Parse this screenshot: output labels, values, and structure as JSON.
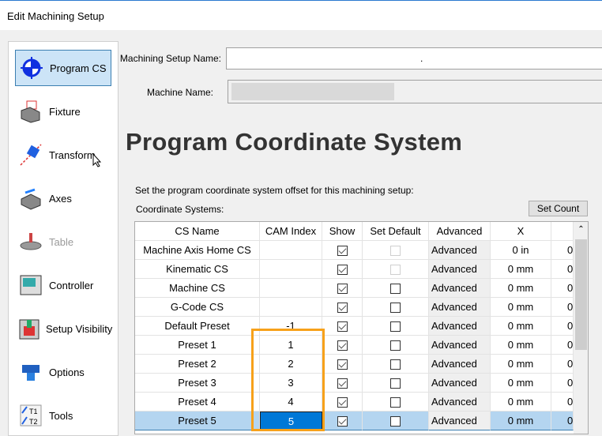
{
  "window": {
    "title": "Edit Machining Setup"
  },
  "sidebar": {
    "items": [
      {
        "label": "Program CS",
        "icon": "program-cs-icon",
        "selected": true
      },
      {
        "label": "Fixture",
        "icon": "fixture-icon"
      },
      {
        "label": "Transform",
        "icon": "transform-icon"
      },
      {
        "label": "Axes",
        "icon": "axes-icon"
      },
      {
        "label": "Table",
        "icon": "table-icon",
        "disabled": true
      },
      {
        "label": "Controller",
        "icon": "controller-icon"
      },
      {
        "label": "Setup Visibility",
        "icon": "setup-visibility-icon"
      },
      {
        "label": "Options",
        "icon": "options-icon"
      },
      {
        "label": "Tools",
        "icon": "tools-icon"
      }
    ]
  },
  "form": {
    "setup_name_label": "Machining Setup Name:",
    "setup_name_value": ".",
    "machine_name_label": "Machine Name:",
    "machine_name_value": ""
  },
  "main": {
    "heading": "Program Coordinate System",
    "description": "Set the program coordinate system offset for this machining setup:",
    "cs_label": "Coordinate Systems:",
    "set_count_label": "Set Count"
  },
  "table": {
    "columns": [
      "CS Name",
      "CAM Index",
      "Show",
      "Set Default",
      "Advanced",
      "X",
      ""
    ],
    "rows": [
      {
        "name": "Machine Axis Home CS",
        "cam": "",
        "show": true,
        "def": false,
        "def_disabled": true,
        "adv": "Advanced",
        "x": "0 in",
        "y": "0"
      },
      {
        "name": "Kinematic CS",
        "cam": "",
        "show": true,
        "def": false,
        "def_disabled": true,
        "adv": "Advanced",
        "x": "0 mm",
        "y": "0"
      },
      {
        "name": "Machine CS",
        "cam": "",
        "show": true,
        "def": false,
        "adv": "Advanced",
        "x": "0 mm",
        "y": "0"
      },
      {
        "name": "G-Code CS",
        "cam": "",
        "show": true,
        "def": false,
        "adv": "Advanced",
        "x": "0 mm",
        "y": "0"
      },
      {
        "name": "Default Preset",
        "cam": "-1",
        "show": true,
        "def": false,
        "adv": "Advanced",
        "x": "0 mm",
        "y": "0"
      },
      {
        "name": "Preset 1",
        "cam": "1",
        "show": true,
        "def": false,
        "adv": "Advanced",
        "x": "0 mm",
        "y": "0"
      },
      {
        "name": "Preset 2",
        "cam": "2",
        "show": true,
        "def": false,
        "adv": "Advanced",
        "x": "0 mm",
        "y": "0"
      },
      {
        "name": "Preset 3",
        "cam": "3",
        "show": true,
        "def": false,
        "adv": "Advanced",
        "x": "0 mm",
        "y": "0"
      },
      {
        "name": "Preset 4",
        "cam": "4",
        "show": true,
        "def": false,
        "adv": "Advanced",
        "x": "0 mm",
        "y": "0"
      },
      {
        "name": "Preset 5",
        "cam": "5",
        "show": true,
        "def": false,
        "adv": "Advanced",
        "x": "0 mm",
        "y": "0",
        "selected": true
      }
    ]
  },
  "colors": {
    "accent": "#0078d7",
    "highlight": "#f7a11a",
    "selection": "#b4d5f0"
  }
}
